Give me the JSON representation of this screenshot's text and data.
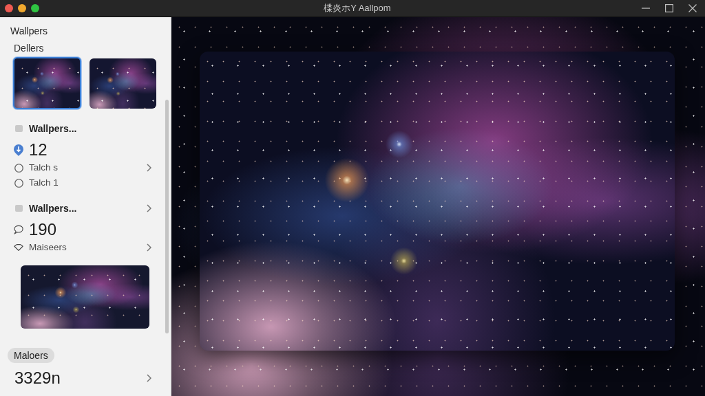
{
  "window": {
    "title": "楪炎ホY Aallpom"
  },
  "sidebar": {
    "title": "Wallpers",
    "section": "Dellers",
    "thumbnails": [
      {
        "selected": true
      },
      {
        "selected": false
      }
    ],
    "items": [
      {
        "kind": "group",
        "label": "Wallpers...",
        "chevron": false
      },
      {
        "kind": "pinned",
        "label": "12",
        "chevron": false
      },
      {
        "kind": "option",
        "label": "Talch s",
        "chevron": true
      },
      {
        "kind": "option",
        "label": "Talch 1",
        "chevron": false
      },
      {
        "kind": "group",
        "label": "Wallpers...",
        "chevron": true
      },
      {
        "kind": "comments",
        "label": "190",
        "chevron": false
      },
      {
        "kind": "tagged",
        "label": "Maiseers",
        "chevron": true
      },
      {
        "kind": "photo",
        "chevron": false
      },
      {
        "kind": "chip",
        "label": "Maloers",
        "chevron": false
      },
      {
        "kind": "total",
        "label": "3329n",
        "chevron": true
      }
    ]
  }
}
